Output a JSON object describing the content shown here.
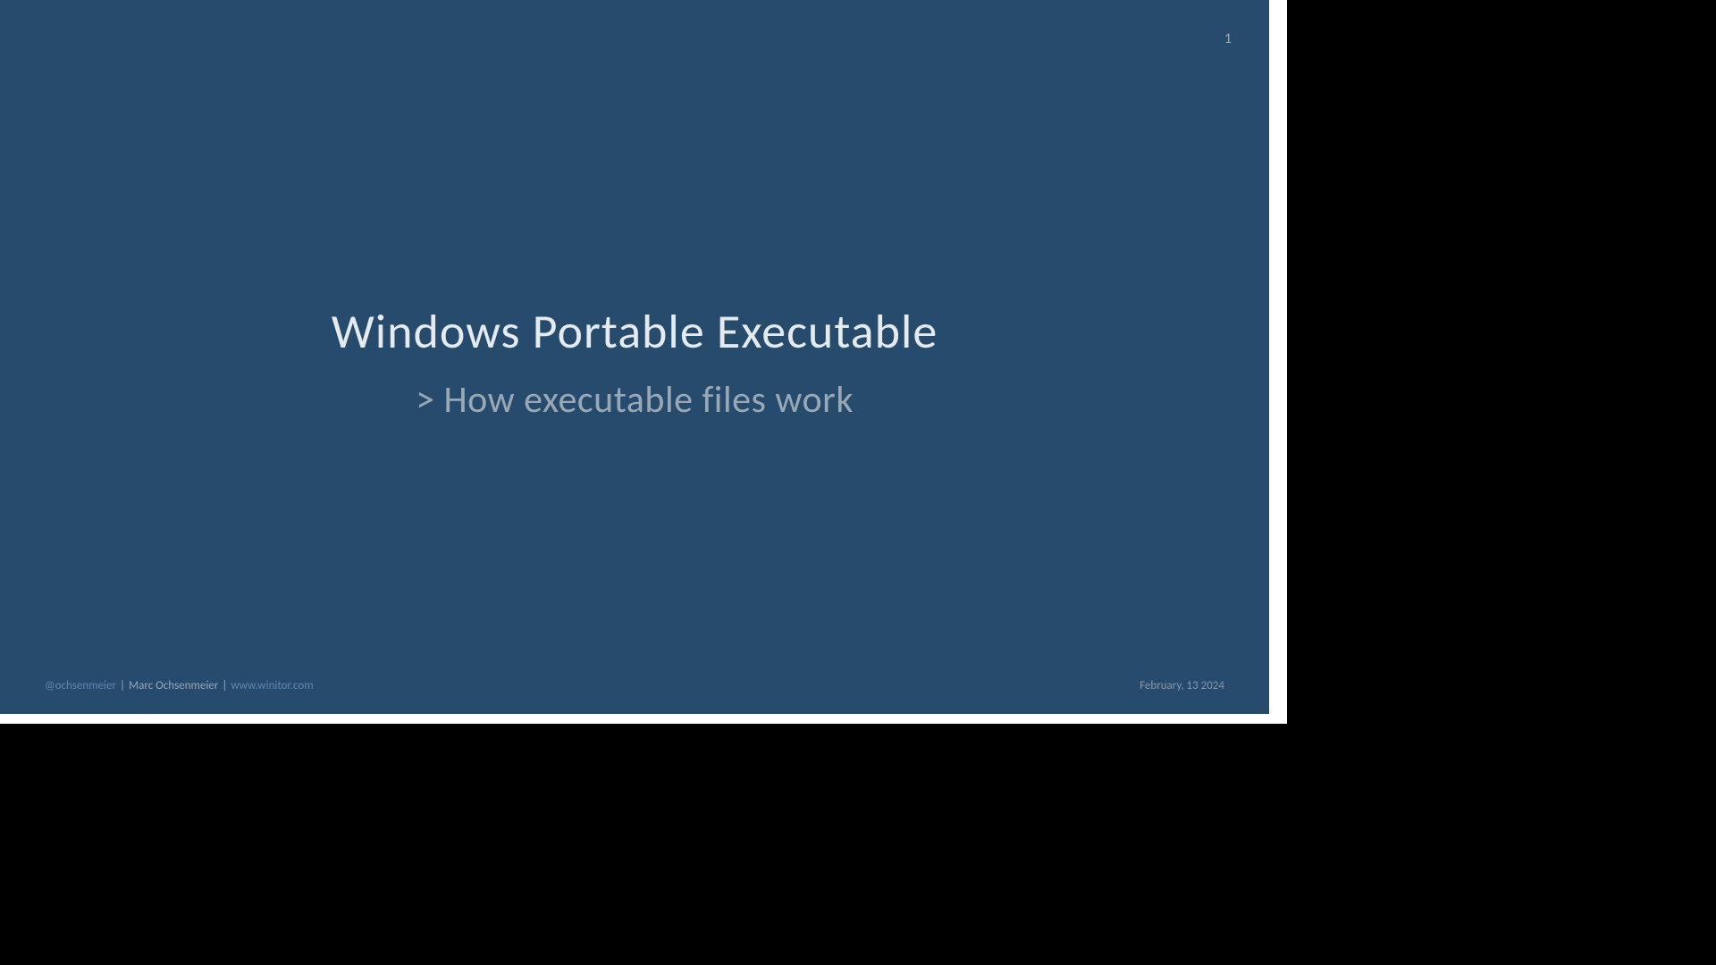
{
  "slide": {
    "page_number": "1",
    "title": "Windows Portable Executable",
    "subtitle": "> How executable files work"
  },
  "footer": {
    "handle": "@ochsenmeier",
    "separator1": " | ",
    "author": "Marc Ochsenmeier",
    "separator2": " | ",
    "url": "www.winitor.com",
    "date": "February, 13 2024"
  }
}
